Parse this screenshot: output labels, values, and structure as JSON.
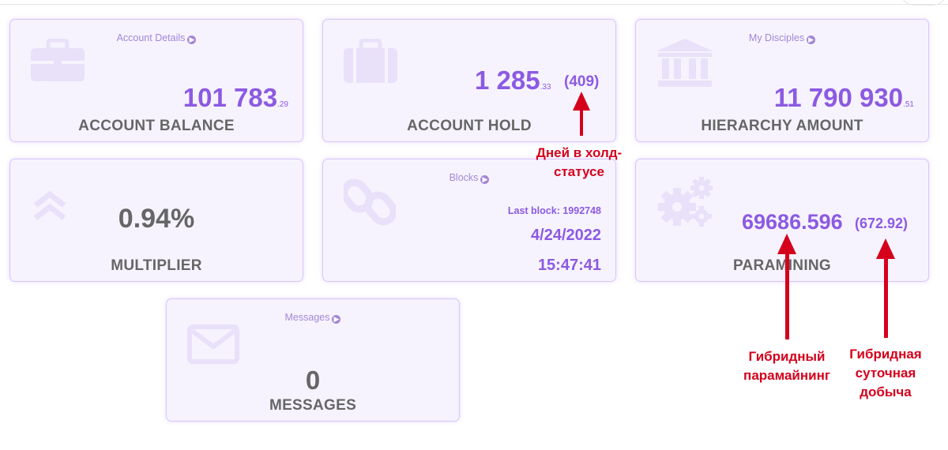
{
  "cards": {
    "balance": {
      "link": "Account Details",
      "value_int": "101 783",
      "value_dec": ".29",
      "label": "ACCOUNT BALANCE"
    },
    "hold": {
      "value_int": "1 285",
      "value_dec": ".33",
      "days": "(409)",
      "label": "ACCOUNT HOLD"
    },
    "hierarchy": {
      "link": "My Disciples",
      "value_int": "11 790 930",
      "value_dec": ".51",
      "label": "HIERARCHY AMOUNT"
    },
    "multiplier": {
      "value": "0.94%",
      "label": "MULTIPLIER"
    },
    "blocks": {
      "link": "Blocks",
      "last_block": "Last block: 1992748",
      "date": "4/24/2022",
      "time": "15:47:41"
    },
    "paramining": {
      "value": "69686.596",
      "daily": "(672.92)",
      "label": "PARAMINING"
    },
    "messages": {
      "link": "Messages",
      "count": "0",
      "label": "MESSAGES"
    }
  },
  "annotations": {
    "hold_days": "Дней в холд-статусе",
    "hybrid_paramining": "Гибридный парамайнинг",
    "hybrid_daily": "Гибридная суточная добыча"
  },
  "colors": {
    "accent": "#8c5ae2",
    "card_bg": "#f6f3ff",
    "icon": "#e9e0f9",
    "annotation": "#d4001c"
  }
}
